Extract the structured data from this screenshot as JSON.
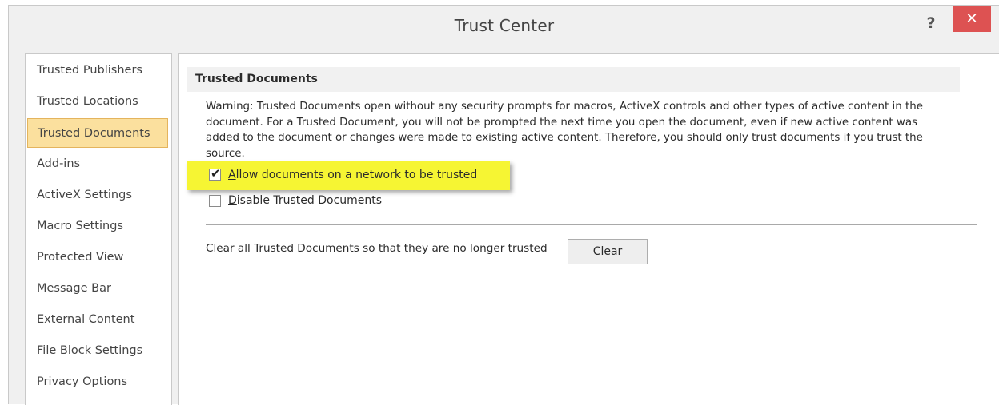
{
  "window": {
    "title": "Trust Center",
    "help_glyph": "?",
    "close_glyph": "✕"
  },
  "sidebar": {
    "selected": "Trusted Documents",
    "items": [
      {
        "label": "Trusted Publishers"
      },
      {
        "label": "Trusted Locations"
      },
      {
        "label": "Trusted Documents"
      },
      {
        "label": "Add-ins"
      },
      {
        "label": "ActiveX Settings"
      },
      {
        "label": "Macro Settings"
      },
      {
        "label": "Protected View"
      },
      {
        "label": "Message Bar"
      },
      {
        "label": "External Content"
      },
      {
        "label": "File Block Settings"
      },
      {
        "label": "Privacy Options"
      }
    ]
  },
  "main": {
    "section_title": "Trusted Documents",
    "warning_text": "Warning: Trusted Documents open without any security prompts for macros, ActiveX controls and other types of active content in the document.  For a Trusted Document, you will not be prompted the next time you open the document, even if new active content was added to the document or changes were made to existing active content. Therefore, you should only trust documents if you trust the source.",
    "options": [
      {
        "mnemonic": "A",
        "rest": "llow documents on a network to be trusted",
        "checked": true
      },
      {
        "mnemonic": "D",
        "rest": "isable Trusted Documents",
        "checked": false
      }
    ],
    "clear_description": "Clear all Trusted Documents so that they are no longer trusted",
    "clear_button": {
      "mnemonic": "C",
      "rest": "lear"
    }
  },
  "colors": {
    "selected_item_bg": "#fbe09e",
    "highlight": "#f6f533",
    "close_button": "#dd5252"
  }
}
